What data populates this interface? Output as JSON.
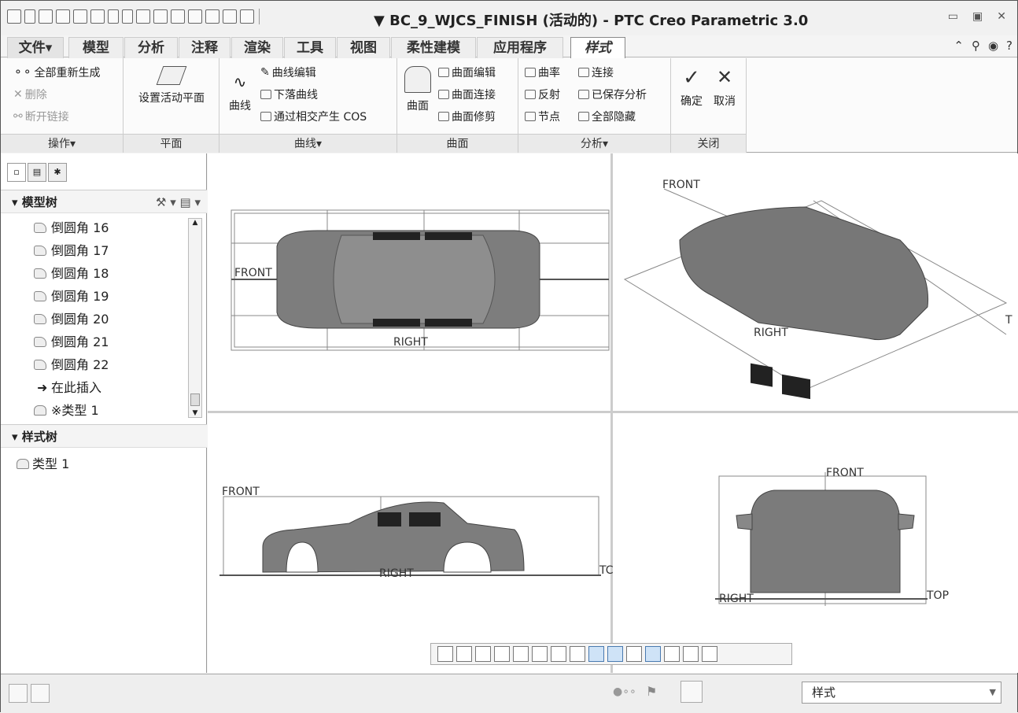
{
  "window": {
    "title": "▼ BC_9_WJCS_FINISH (活动的) - PTC Creo Parametric 3.0",
    "controls": [
      "minimize-icon",
      "restore-icon",
      "close-icon"
    ]
  },
  "tabs": [
    "文件▾",
    "模型",
    "分析",
    "注释",
    "渲染",
    "工具",
    "视图",
    "柔性建模",
    "应用程序",
    "样式"
  ],
  "active_tab": "样式",
  "ribbon": {
    "ops": {
      "regen": "全部重新生成",
      "delete": "删除",
      "unlink": "断开链接",
      "label": "操作▾"
    },
    "plane": {
      "set_active": "设置活动平面",
      "label": "平面"
    },
    "curves": {
      "curve": "曲线",
      "edit": "曲线编辑",
      "drop": "下落曲线",
      "cos": "通过相交产生 COS",
      "label": "曲线▾"
    },
    "surfaces": {
      "surface": "曲面",
      "edit": "曲面编辑",
      "connect": "曲面连接",
      "trim": "曲面修剪",
      "label": "曲面"
    },
    "analysis": {
      "curvature": "曲率",
      "connection": "连接",
      "reflect": "反射",
      "saved": "已保存分析",
      "node": "节点",
      "hide_all": "全部隐藏",
      "label": "分析▾"
    },
    "close": {
      "ok": "确定",
      "cancel": "取消",
      "label": "关闭"
    }
  },
  "sidebar": {
    "model_tree_header": "模型树",
    "items": [
      "倒圆角 16",
      "倒圆角 17",
      "倒圆角 18",
      "倒圆角 19",
      "倒圆角 20",
      "倒圆角 21",
      "倒圆角 22"
    ],
    "insert_here": "在此插入",
    "type_item": "※类型 1",
    "style_tree_header": "样式树",
    "style_item": "类型 1"
  },
  "viewport": {
    "front": "FRONT",
    "right": "RIGHT",
    "top": "TOP",
    "top_cut": "T",
    "top_cut2": "TC"
  },
  "status": {
    "selector": "样式"
  }
}
